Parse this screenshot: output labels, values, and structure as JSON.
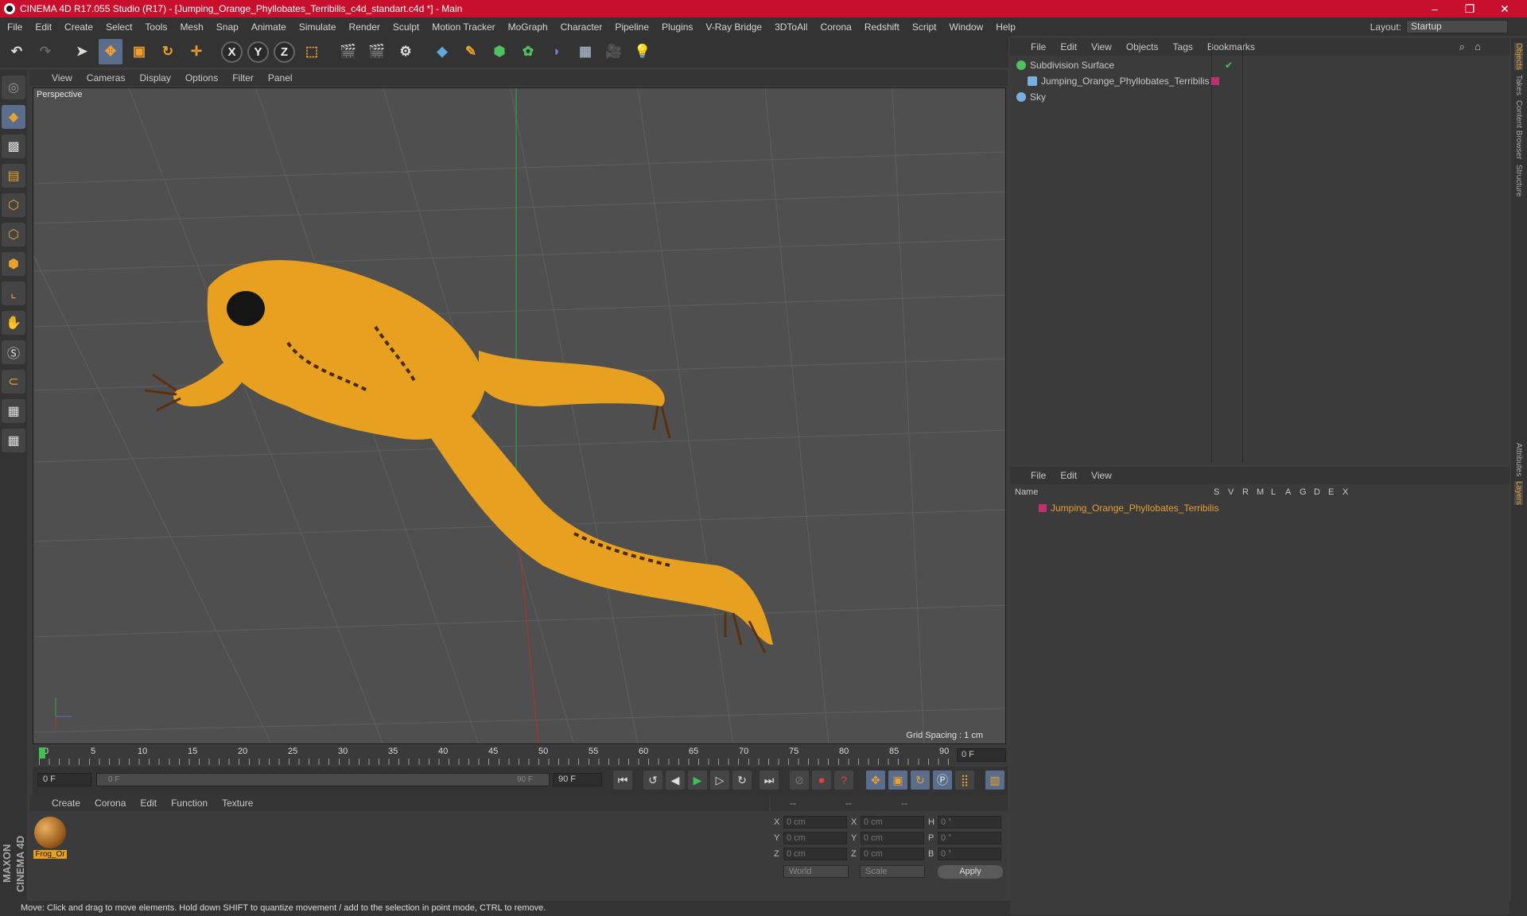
{
  "title": "CINEMA 4D R17.055 Studio (R17) - [Jumping_Orange_Phyllobates_Terribilis_c4d_standart.c4d *] - Main",
  "menu": [
    "File",
    "Edit",
    "Create",
    "Select",
    "Tools",
    "Mesh",
    "Snap",
    "Animate",
    "Simulate",
    "Render",
    "Sculpt",
    "Motion Tracker",
    "MoGraph",
    "Character",
    "Pipeline",
    "Plugins",
    "V-Ray Bridge",
    "3DToAll",
    "Corona",
    "Redshift",
    "Script",
    "Window",
    "Help"
  ],
  "layout": {
    "label": "Layout:",
    "value": "Startup"
  },
  "viewport": {
    "menu": [
      "View",
      "Cameras",
      "Display",
      "Options",
      "Filter",
      "Panel"
    ],
    "label": "Perspective",
    "grid_spacing": "Grid Spacing : 1 cm"
  },
  "timeline": {
    "ticks": [
      "0",
      "5",
      "10",
      "15",
      "20",
      "25",
      "30",
      "35",
      "40",
      "45",
      "50",
      "55",
      "60",
      "65",
      "70",
      "75",
      "80",
      "85",
      "90"
    ],
    "current": "0 F",
    "start": "0 F",
    "range_start": "0 F",
    "range_end": "90 F",
    "end": "90 F"
  },
  "materials": {
    "menu": [
      "Create",
      "Corona",
      "Edit",
      "Function",
      "Texture"
    ],
    "items": [
      {
        "name": "Frog_Or"
      }
    ]
  },
  "coords": {
    "headers": [
      "--",
      "--",
      "--"
    ],
    "rows": [
      {
        "a": "X",
        "av": "0 cm",
        "b": "X",
        "bv": "0 cm",
        "c": "H",
        "cv": "0 °"
      },
      {
        "a": "Y",
        "av": "0 cm",
        "b": "Y",
        "bv": "0 cm",
        "c": "P",
        "cv": "0 °"
      },
      {
        "a": "Z",
        "av": "0 cm",
        "b": "Z",
        "bv": "0 cm",
        "c": "B",
        "cv": "0 °"
      }
    ],
    "mode": "World",
    "scale": "Scale",
    "apply": "Apply"
  },
  "objects": {
    "menu": [
      "File",
      "Edit",
      "View",
      "Objects",
      "Tags",
      "Bookmarks"
    ],
    "items": [
      "Subdivision Surface",
      "Jumping_Orange_Phyllobates_Terribilis",
      "Sky"
    ]
  },
  "layers": {
    "menu": [
      "File",
      "Edit",
      "View"
    ],
    "header_name": "Name",
    "header_cols": [
      "S",
      "V",
      "R",
      "M",
      "L",
      "A",
      "G",
      "D",
      "E",
      "X"
    ],
    "items": [
      "Jumping_Orange_Phyllobates_Terribilis"
    ]
  },
  "right_tabs": [
    "Objects",
    "Takes",
    "Content Browser",
    "Structure",
    "Attributes",
    "Layers"
  ],
  "status": "Move: Click and drag to move elements. Hold down SHIFT to quantize movement / add to the selection in point mode, CTRL to remove.",
  "brand": "MAXON CINEMA 4D",
  "colors": {
    "title_bar": "#c8102e",
    "accent": "#e8a030",
    "selection": "#5a6e8c",
    "frog": "#e8a020"
  }
}
